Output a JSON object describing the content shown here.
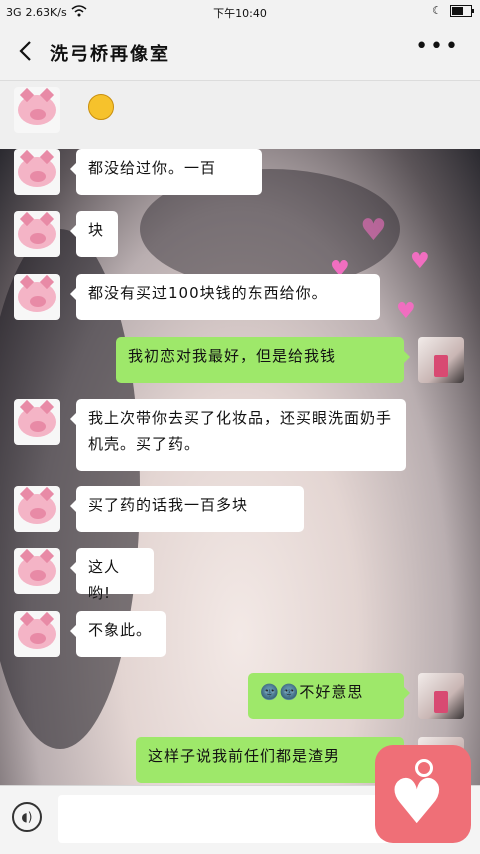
{
  "status_bar": {
    "signal": "3G",
    "speed": "2.63K/s",
    "wifi_icon": "wifi-icon",
    "time": "下午10:40",
    "moon_icon": "moon-icon",
    "battery_level": 0.6
  },
  "header": {
    "title": "洗弓桥再像室",
    "back_icon": "chevron-left-icon",
    "more_icon": "more-dots-icon"
  },
  "messages": [
    {
      "side": "left",
      "text": "😁"
    },
    {
      "side": "left",
      "text": "都没给过你。一百"
    },
    {
      "side": "left",
      "text": "块"
    },
    {
      "side": "left",
      "text": "都没有买过100块钱的东西给你。"
    },
    {
      "side": "right",
      "text": "我初恋对我最好，但是给我钱"
    },
    {
      "side": "left",
      "text": "我上次带你去买了化妆品，还买眼洗面奶手机壳。买了药。"
    },
    {
      "side": "left",
      "text": "买了药的话我一百多块"
    },
    {
      "side": "left",
      "text": "这人哟!"
    },
    {
      "side": "left",
      "text": "不象此。"
    },
    {
      "side": "right",
      "text": "不好意思",
      "emoji": "🌚🌚"
    },
    {
      "side": "right",
      "text": "这样子说我前任们都是渣男"
    }
  ],
  "input": {
    "placeholder": ""
  },
  "voice_icon": "voice-icon",
  "floating_icon": "heart-app-icon",
  "colors": {
    "right_bubble": "#9ee86a",
    "left_bubble": "#ffffff",
    "fab": "#ef6f77"
  }
}
